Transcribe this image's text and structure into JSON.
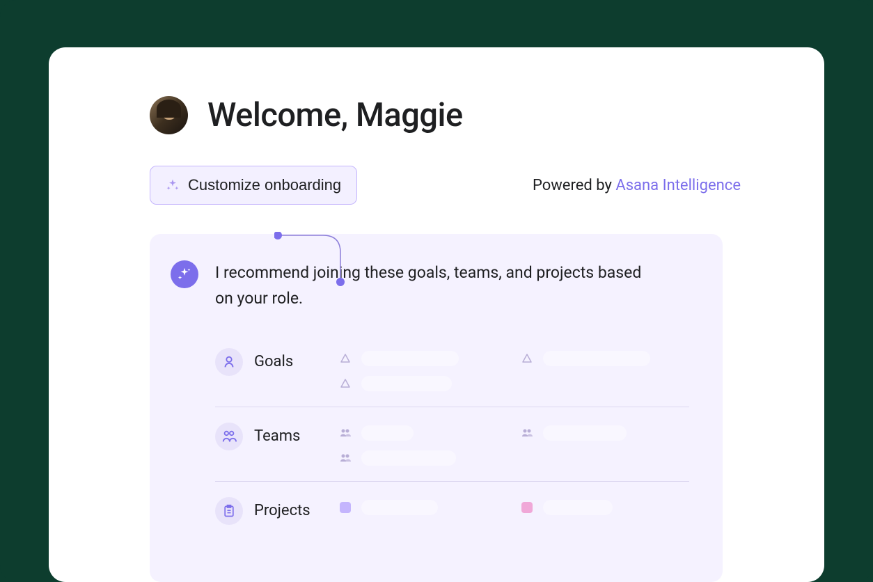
{
  "header": {
    "welcome_text": "Welcome, Maggie"
  },
  "actions": {
    "customize_label": "Customize onboarding",
    "powered_prefix": "Powered by ",
    "powered_brand": "Asana Intelligence"
  },
  "recommendation": {
    "message": "I recommend joining these goals, teams, and projects based on your role."
  },
  "sections": {
    "goals": {
      "label": "Goals"
    },
    "teams": {
      "label": "Teams"
    },
    "projects": {
      "label": "Projects"
    }
  },
  "colors": {
    "accent": "#7c6eeb",
    "card_bg": "#f5f2ff",
    "outer_bg": "#0d3d2e"
  }
}
